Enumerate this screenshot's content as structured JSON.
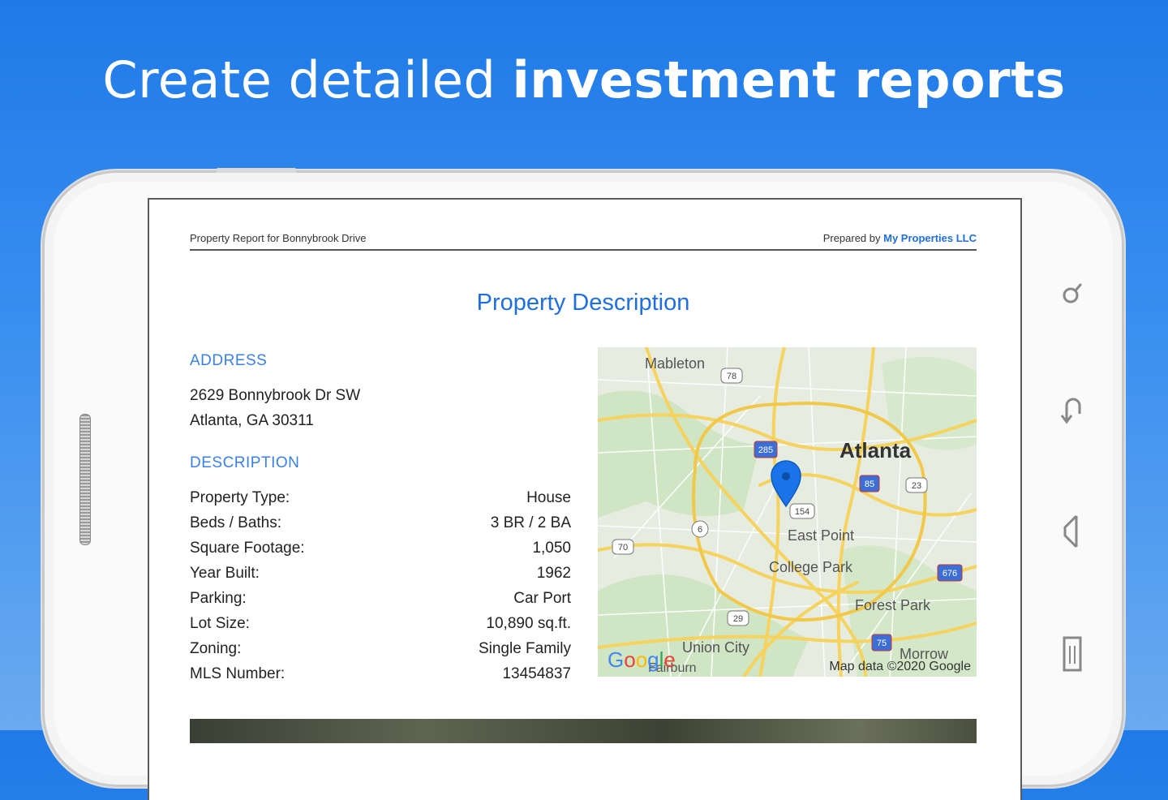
{
  "headline": {
    "light": "Create detailed",
    "bold": "investment reports"
  },
  "report": {
    "header_left": "Property Report for Bonnybrook Drive",
    "header_prepared": "Prepared by",
    "header_company": "My Properties LLC",
    "section_title": "Property Description",
    "address_label": "ADDRESS",
    "address_line1": "2629 Bonnybrook Dr SW",
    "address_line2": "Atlanta, GA 30311",
    "description_label": "DESCRIPTION",
    "rows": [
      {
        "label": "Property Type:",
        "value": "House"
      },
      {
        "label": "Beds / Baths:",
        "value": "3 BR / 2 BA"
      },
      {
        "label": "Square Footage:",
        "value": "1,050"
      },
      {
        "label": "Year Built:",
        "value": "1962"
      },
      {
        "label": "Parking:",
        "value": "Car Port"
      },
      {
        "label": "Lot Size:",
        "value": "10,890 sq.ft."
      },
      {
        "label": "Zoning:",
        "value": "Single Family"
      },
      {
        "label": "MLS Number:",
        "value": "13454837"
      }
    ]
  },
  "map": {
    "places": [
      "Mableton",
      "Atlanta",
      "East Point",
      "College Park",
      "Forest Park",
      "Union City",
      "Morrow",
      "Fairburn"
    ],
    "shields": [
      "78",
      "285",
      "85",
      "23",
      "154",
      "6",
      "70",
      "676",
      "29",
      "75"
    ],
    "logo": "Google",
    "attribution": "Map data ©2020 Google"
  },
  "icons": {
    "nav": [
      "search-icon",
      "back-icon",
      "home-icon",
      "recent-apps-icon"
    ]
  },
  "colors": {
    "accent": "#1f6fe0",
    "background": "#1f7ae8",
    "pin": "#1a73e8"
  }
}
